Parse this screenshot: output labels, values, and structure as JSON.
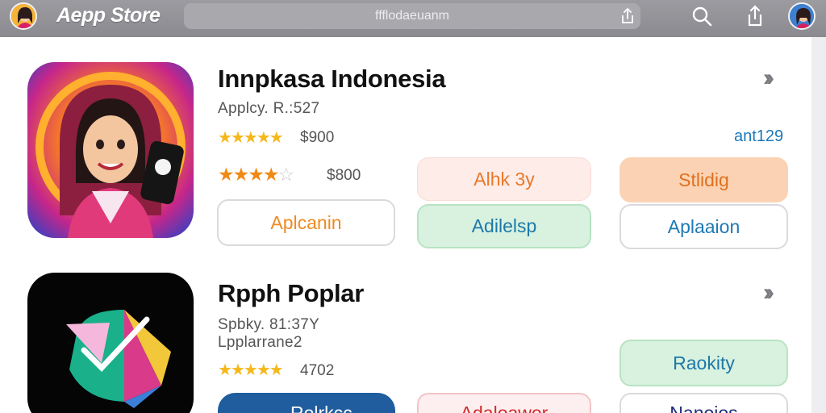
{
  "header": {
    "brand": "Aepp Store",
    "url": "ffflodaeuanm",
    "colors": {
      "bar": "#8e8e94",
      "url_field": "#a8a8ad"
    }
  },
  "apps": [
    {
      "name": "Innpkasa Indonesia",
      "subtitle": "Applcy. R.:527",
      "rating1": {
        "stars_on": 5,
        "stars_total": 5,
        "label": "$900"
      },
      "rating2": {
        "stars_on": 4,
        "stars_total": 5,
        "label": "$800"
      },
      "link_count": "ant129",
      "buttons": {
        "a": "Aplcanin",
        "b": "Alhk 3y",
        "c": "Adilelsp",
        "d": "Stlidig",
        "e": "Aplaaion"
      }
    },
    {
      "name": "Rpph Poplar",
      "subtitle_1": "Spbky. 81:37Y",
      "subtitle_2": "Lpplarrane2",
      "rating": {
        "stars_on": 5,
        "stars_total": 5,
        "label": "4702"
      },
      "buttons": {
        "green": "Raokity",
        "blue": "Rolrkcc",
        "red": "Adaloawor",
        "white": "Nanoios"
      }
    }
  ],
  "icons": [
    "avatar",
    "share-icon",
    "search-icon",
    "share-up-icon",
    "chevron-double-right-icon",
    "star-icon"
  ],
  "colors": {
    "star": "#f5b81c",
    "link": "#1a78b8",
    "peach": "#fbd3b4",
    "green": "#d8f2df",
    "blue": "#1f5d9f"
  }
}
